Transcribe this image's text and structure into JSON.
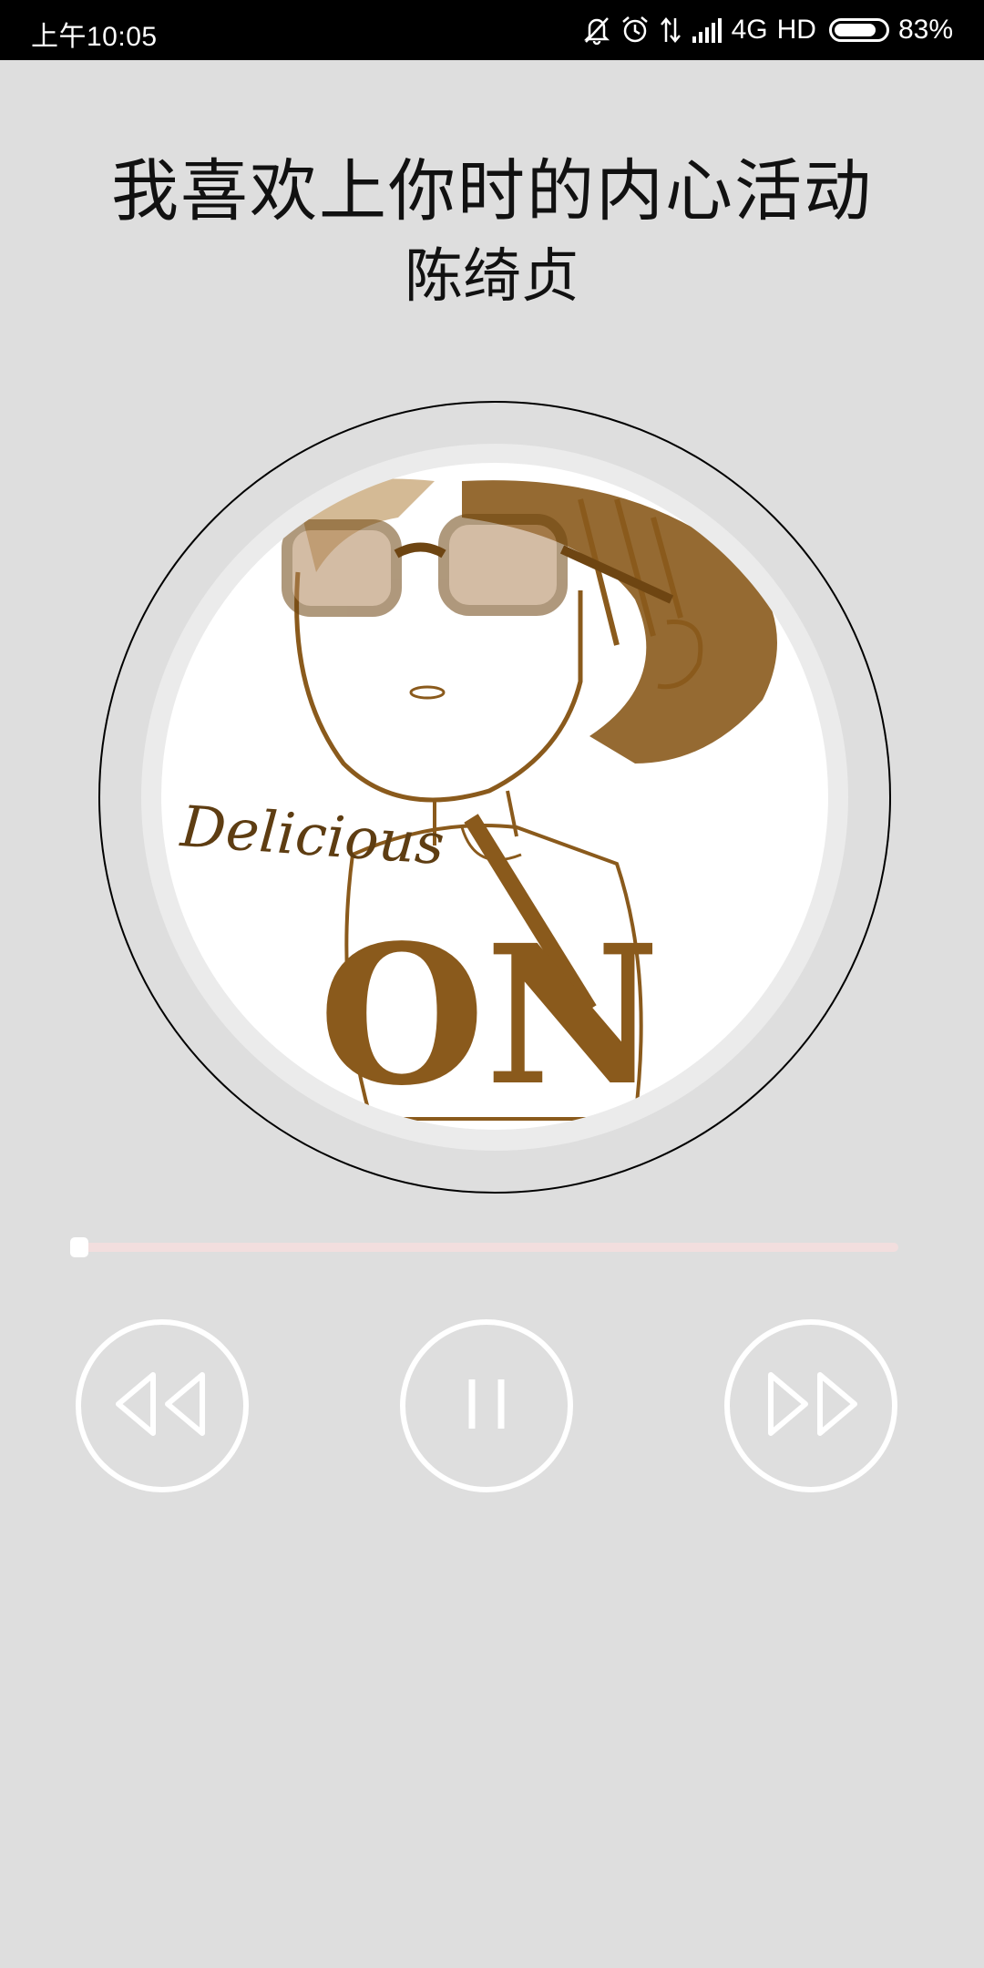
{
  "status_bar": {
    "time": "上午10:05",
    "network": "4G",
    "hd": "HD",
    "battery": "83%",
    "battery_level": 0.83,
    "icons": [
      "mute-icon",
      "alarm-icon",
      "data-transfer-icon",
      "signal-icon",
      "battery-icon"
    ]
  },
  "song": {
    "title": "我喜欢上你时的内心活动",
    "artist": "陈绮贞"
  },
  "album_art": {
    "text_delicious": "Delicious",
    "text_on": "ON"
  },
  "player": {
    "progress": 0.0,
    "controls": [
      "rewind-icon",
      "pause-icon",
      "fast-forward-icon"
    ]
  },
  "colors": {
    "background": "#dedede",
    "status_bar": "#000000",
    "progress_track": "#f2dede",
    "control_stroke": "#ffffff",
    "art_ink": "#8a5a1c"
  }
}
